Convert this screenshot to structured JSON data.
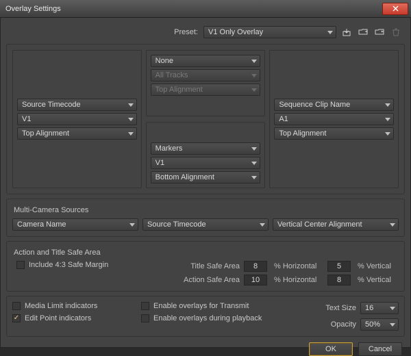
{
  "window": {
    "title": "Overlay Settings"
  },
  "preset": {
    "label": "Preset:",
    "value": "V1 Only Overlay"
  },
  "positions": {
    "left": {
      "type": "Source Timecode",
      "track": "V1",
      "align": "Top Alignment"
    },
    "top": {
      "type": "None",
      "track": "All Tracks",
      "align": "Top Alignment"
    },
    "bottom": {
      "type": "Markers",
      "track": "V1",
      "align": "Bottom Alignment"
    },
    "right": {
      "type": "Sequence Clip Name",
      "track": "A1",
      "align": "Top Alignment"
    }
  },
  "multicam": {
    "heading": "Multi-Camera Sources",
    "name": "Camera Name",
    "tc": "Source Timecode",
    "align": "Vertical Center Alignment"
  },
  "safe": {
    "heading": "Action and Title Safe Area",
    "include_43": {
      "label": "Include 4:3 Safe Margin",
      "checked": false
    },
    "title_label": "Title Safe Area",
    "action_label": "Action Safe Area",
    "hpct_label": "% Horizontal",
    "vpct_label": "% Vertical",
    "title_h": "8",
    "title_v": "5",
    "action_h": "10",
    "action_v": "8"
  },
  "bottom": {
    "media_limit": {
      "label": "Media Limit indicators",
      "checked": false
    },
    "edit_point": {
      "label": "Edit Point indicators",
      "checked": true
    },
    "transmit": {
      "label": "Enable overlays for Transmit",
      "checked": false
    },
    "playback": {
      "label": "Enable overlays during playback",
      "checked": false
    },
    "text_size": {
      "label": "Text Size",
      "value": "16"
    },
    "opacity": {
      "label": "Opacity",
      "value": "50%"
    }
  },
  "buttons": {
    "ok": "OK",
    "cancel": "Cancel"
  }
}
